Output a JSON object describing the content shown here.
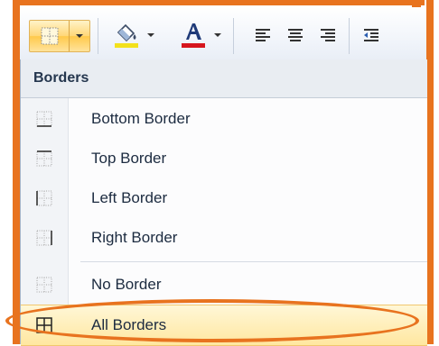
{
  "toolbar": {
    "borders_button": "borders-icon",
    "fill_color_button": "fill-color-icon",
    "font_color_button": "font-color-icon",
    "align_buttons": [
      "align-left-icon",
      "align-center-icon",
      "align-right-icon",
      "decrease-indent-icon"
    ],
    "fill_color": "#f3e11b",
    "font_color": "#d6161d"
  },
  "menu": {
    "header": "Borders",
    "items": [
      {
        "label": "Bottom Border",
        "icon": "bottom-border-icon"
      },
      {
        "label": "Top Border",
        "icon": "top-border-icon"
      },
      {
        "label": "Left Border",
        "icon": "left-border-icon"
      },
      {
        "label": "Right Border",
        "icon": "right-border-icon"
      },
      {
        "label": "No Border",
        "icon": "no-border-icon"
      },
      {
        "label": "All Borders",
        "icon": "all-borders-icon",
        "selected": true
      }
    ]
  },
  "colors": {
    "annotation": "#e8731f",
    "highlight": "#ffe7a0"
  }
}
